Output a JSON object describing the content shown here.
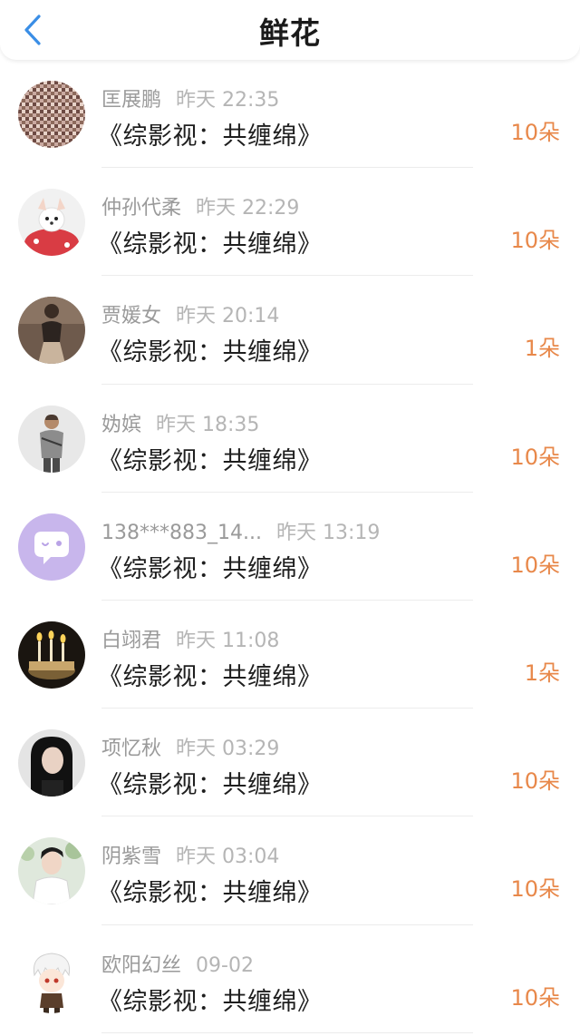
{
  "header": {
    "title": "鲜花",
    "back_icon": "chevron-left-icon",
    "accent_color": "#3a8ee6"
  },
  "colors": {
    "name": "#9a9a9a",
    "time": "#b5b5b5",
    "count": "#e8884a"
  },
  "items": [
    {
      "name": "匡展鹏",
      "time": "昨天 22:35",
      "work": "《综影视：共缠绵》",
      "count": "10朵",
      "avatar": "mosaic-photo"
    },
    {
      "name": "仲孙代柔",
      "time": "昨天 22:29",
      "work": "《综影视：共缠绵》",
      "count": "10朵",
      "avatar": "puppy-photo"
    },
    {
      "name": "贾媛女",
      "time": "昨天 20:14",
      "work": "《综影视：共缠绵》",
      "count": "1朵",
      "avatar": "woman-photo"
    },
    {
      "name": "妫嫔",
      "time": "昨天 18:35",
      "work": "《综影视：共缠绵》",
      "count": "10朵",
      "avatar": "game-character-photo"
    },
    {
      "name": "138***883_14...",
      "time": "昨天 13:19",
      "work": "《综影视：共缠绵》",
      "count": "10朵",
      "avatar": "default-chat-bubble"
    },
    {
      "name": "白翊君",
      "time": "昨天 11:08",
      "work": "《综影视：共缠绵》",
      "count": "1朵",
      "avatar": "candles-photo"
    },
    {
      "name": "项忆秋",
      "time": "昨天 03:29",
      "work": "《综影视：共缠绵》",
      "count": "10朵",
      "avatar": "girl-photo"
    },
    {
      "name": "阴紫雪",
      "time": "昨天 03:04",
      "work": "《综影视：共缠绵》",
      "count": "10朵",
      "avatar": "boy-photo"
    },
    {
      "name": "欧阳幻丝",
      "time": "09-02",
      "work": "《综影视：共缠绵》",
      "count": "10朵",
      "avatar": "anime-character"
    }
  ]
}
